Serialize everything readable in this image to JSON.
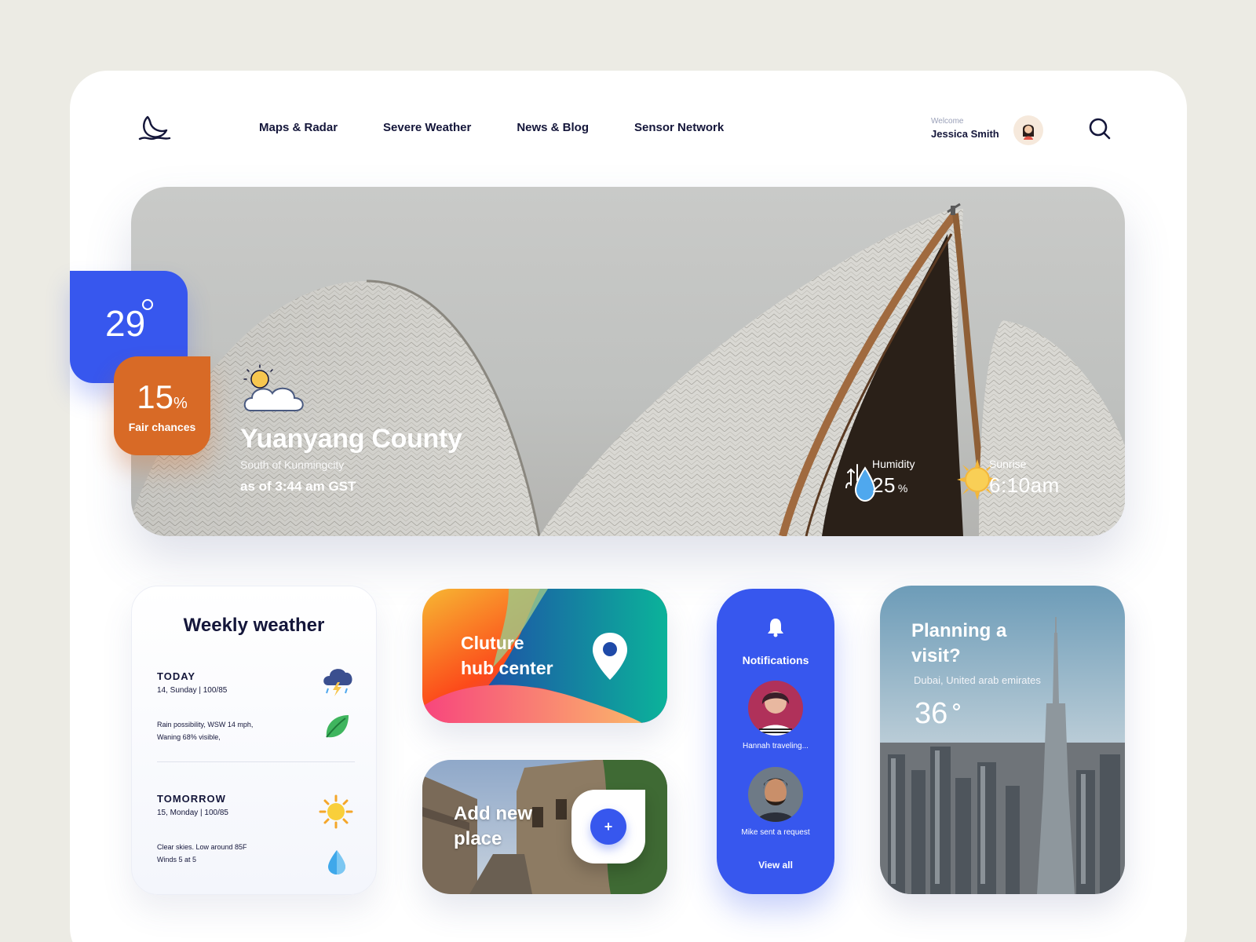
{
  "header": {
    "nav": [
      "Maps & Radar",
      "Severe Weather",
      "News & Blog",
      "Sensor Network"
    ],
    "welcome": "Welcome",
    "user_name": "Jessica Smith"
  },
  "hero": {
    "temperature": "29",
    "chance_value": "15",
    "chance_unit": "%",
    "chance_label": "Fair chances",
    "location": "Yuanyang County",
    "sublocation": "South of Kunmingcity",
    "as_of": "as of 3:44 am GST",
    "humidity_label": "Humidity",
    "humidity_value": "25",
    "humidity_unit": "%",
    "sunrise_label": "Sunrise",
    "sunrise_value": "6:10am"
  },
  "weekly": {
    "title": "Weekly weather",
    "days": [
      {
        "name": "TODAY",
        "date": "14, Sunday  |  100/85",
        "desc1": "Rain possibility, WSW 14 mph,",
        "desc2": "Waning 68% visible,"
      },
      {
        "name": "TOMORROW",
        "date": "15, Monday  |  100/85",
        "desc1": "Clear skies. Low around 85F",
        "desc2": "Winds 5 at 5"
      }
    ]
  },
  "culture": {
    "line1": "Cluture",
    "line2": "hub center"
  },
  "add_place": {
    "line1": "Add new",
    "line2": "place",
    "button": "+"
  },
  "notifications": {
    "title": "Notifications",
    "items": [
      {
        "message": "Hannah traveling..."
      },
      {
        "message": "Mike sent a request"
      }
    ],
    "view_all": "View all"
  },
  "planning": {
    "line1": "Planning a",
    "line2": "visit?",
    "location": "Dubai, United arab emirates",
    "temperature": "36"
  }
}
